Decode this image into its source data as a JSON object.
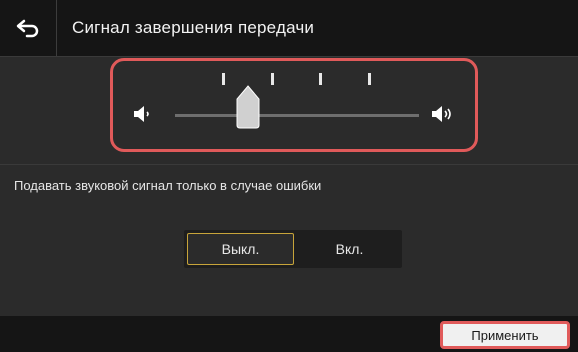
{
  "header": {
    "title": "Сигнал завершения передачи",
    "back_icon": "back-arrow-icon"
  },
  "volume": {
    "level": 2,
    "max_level": 5,
    "low_icon": "speaker-low-icon",
    "high_icon": "speaker-high-icon"
  },
  "option": {
    "label": "Подавать звуковой сигнал только в случае ошибки",
    "choices": [
      "Выкл.",
      "Вкл."
    ],
    "selected": "Выкл."
  },
  "footer": {
    "apply_label": "Применить"
  },
  "colors": {
    "highlight": "#e05a5a",
    "selected_border": "#c7a43a",
    "background": "#2b2b2b",
    "header": "#151515"
  }
}
